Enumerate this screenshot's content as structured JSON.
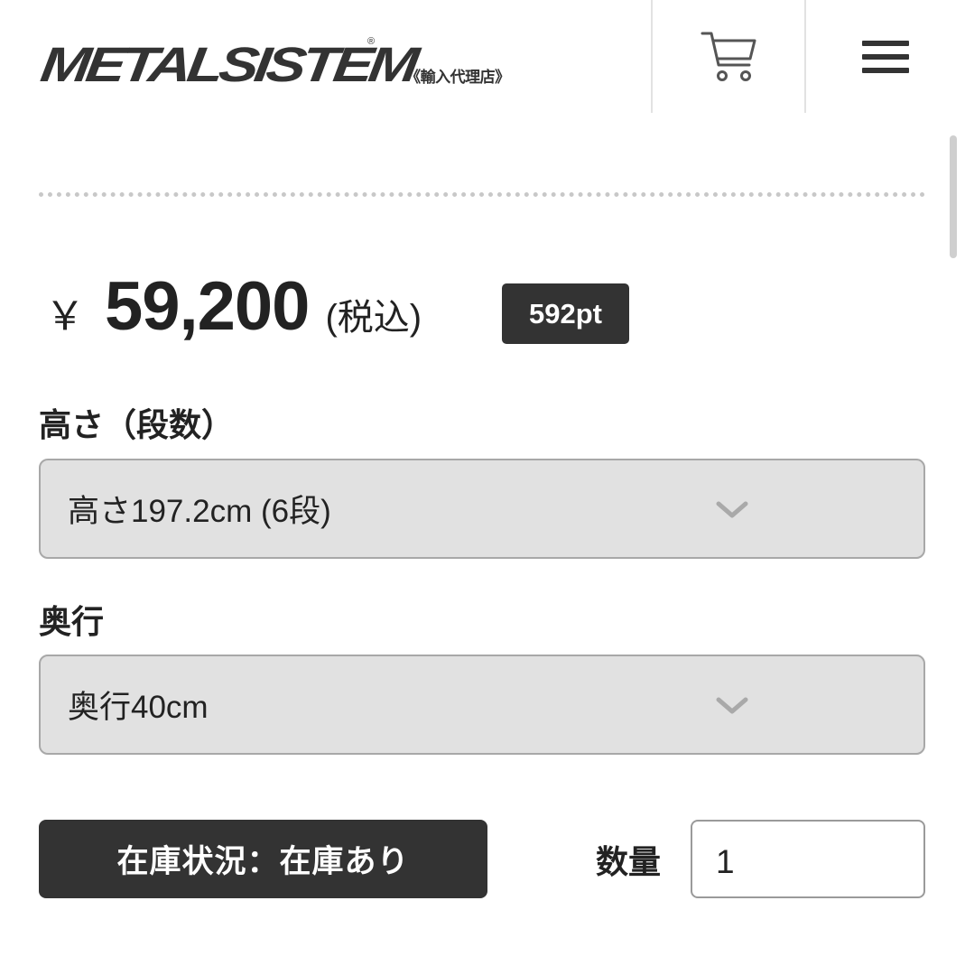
{
  "header": {
    "logo_text": "METALSISTEM",
    "logo_reg": "®",
    "logo_sub": "《輸入代理店》",
    "cart_icon": "cart-icon",
    "menu_icon": "hamburger-menu-icon"
  },
  "price": {
    "currency": "￥",
    "amount": "59,200",
    "tax_label": "(税込)",
    "points": "592pt"
  },
  "height_field": {
    "label": "高さ（段数）",
    "selected": "高さ197.2cm (6段)"
  },
  "depth_field": {
    "label": "奥行",
    "selected": "奥行40cm"
  },
  "stock": {
    "label": "在庫状況：在庫あり"
  },
  "quantity": {
    "label": "数量",
    "value": "1"
  },
  "colors": {
    "dark": "#333333",
    "select_bg": "#e1e1e1"
  }
}
